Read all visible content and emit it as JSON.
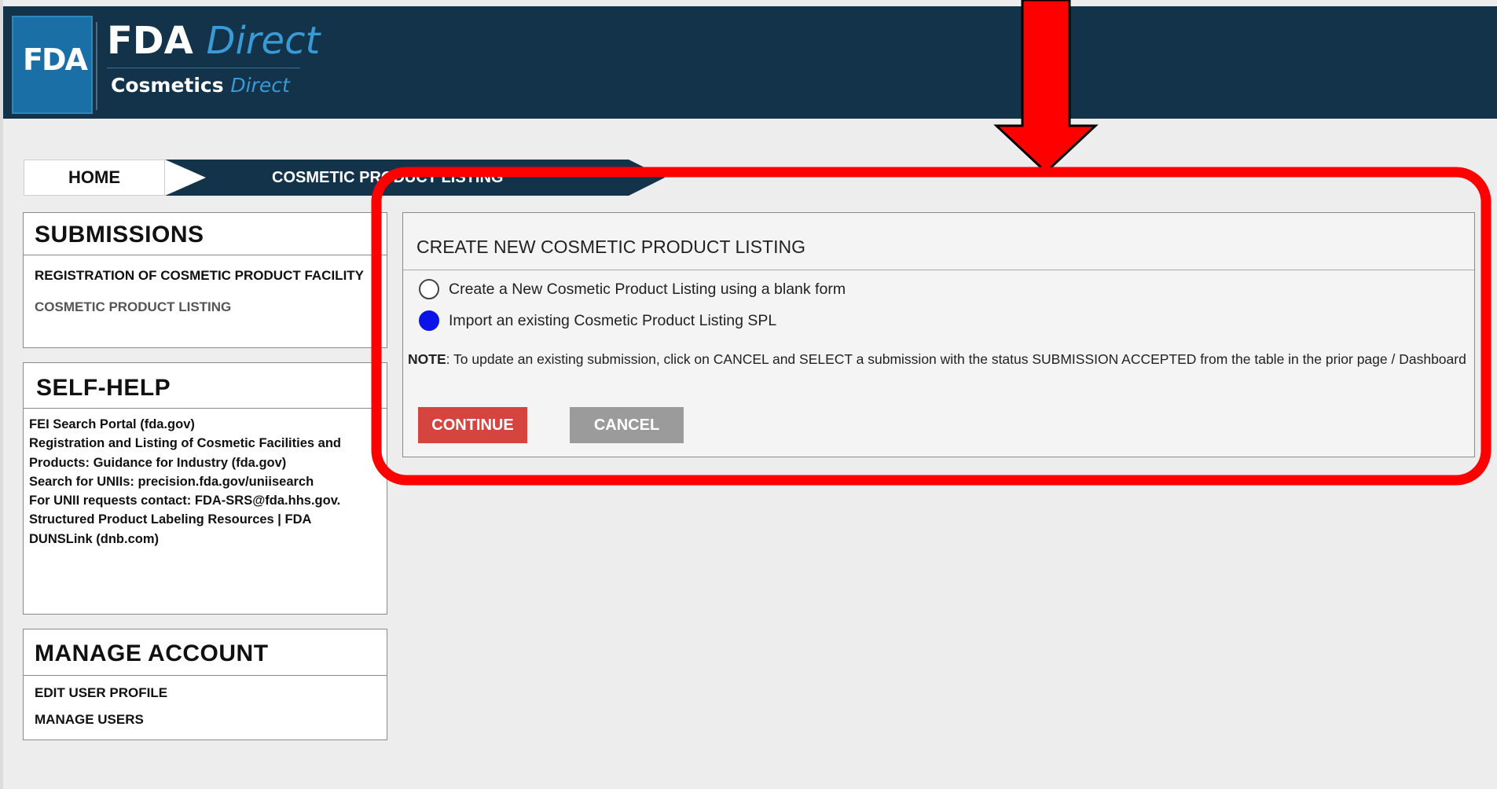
{
  "header": {
    "logo_badge": "FDA",
    "brand_main": "FDA",
    "brand_accent": "Direct",
    "product_main": "Cosmetics",
    "product_accent": "Direct"
  },
  "breadcrumb": {
    "home": "HOME",
    "current": "COSMETIC PRODUCT LISTING"
  },
  "submissions": {
    "title": "SUBMISSIONS",
    "items": [
      "REGISTRATION OF COSMETIC PRODUCT FACILITY",
      "COSMETIC PRODUCT LISTING"
    ]
  },
  "self_help": {
    "title": "SELF-HELP",
    "links": [
      "FEI Search Portal (fda.gov)",
      "Registration and Listing of Cosmetic Facilities and",
      "Products: Guidance for Industry (fda.gov)",
      "Search for UNIIs: precision.fda.gov/uniisearch",
      "For UNII requests contact:  FDA-SRS@fda.hhs.gov.",
      "Structured Product Labeling Resources | FDA",
      "DUNSLink (dnb.com)"
    ]
  },
  "manage_account": {
    "title": "MANAGE ACCOUNT",
    "items": [
      "EDIT USER PROFILE",
      "MANAGE USERS"
    ]
  },
  "main": {
    "title": "CREATE NEW COSMETIC PRODUCT LISTING",
    "options": [
      {
        "label": "Create a New Cosmetic Product Listing using a blank form",
        "selected": false
      },
      {
        "label": "Import an existing Cosmetic Product Listing SPL",
        "selected": true
      }
    ],
    "note_label": "NOTE",
    "note_text": ": To update an existing submission, click on CANCEL and SELECT a submission with the status SUBMISSION ACCEPTED from the table in the prior page / Dashboard",
    "continue_label": "CONTINUE",
    "cancel_label": "CANCEL"
  },
  "colors": {
    "header_bg": "#12334a",
    "accent_blue": "#3a9ad6",
    "continue_red": "#d6443f",
    "cancel_gray": "#9b9b9b",
    "annotation_red": "#ff0000",
    "radio_selected": "#0b13e8"
  }
}
